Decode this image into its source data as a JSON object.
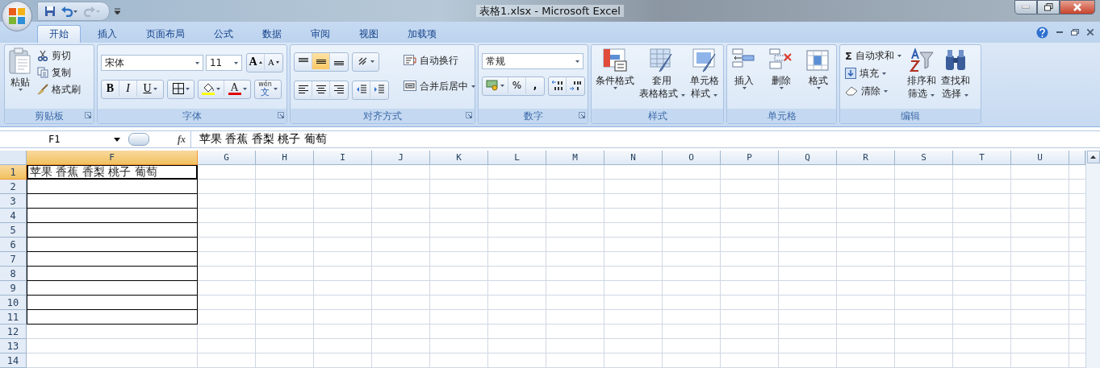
{
  "window": {
    "title": "表格1.xlsx  -  Microsoft Excel"
  },
  "tabs": [
    {
      "label": "开始",
      "selected": true
    },
    {
      "label": "插入",
      "selected": false
    },
    {
      "label": "页面布局",
      "selected": false
    },
    {
      "label": "公式",
      "selected": false
    },
    {
      "label": "数据",
      "selected": false
    },
    {
      "label": "审阅",
      "selected": false
    },
    {
      "label": "视图",
      "selected": false
    },
    {
      "label": "加载项",
      "selected": false
    }
  ],
  "ribbon": {
    "clipboard": {
      "label": "剪贴板",
      "paste": "粘贴",
      "cut": "剪切",
      "copy": "复制",
      "format_painter": "格式刷"
    },
    "font": {
      "label": "字体",
      "font_name": "宋体",
      "font_size": "11",
      "grow": "A",
      "shrink": "A",
      "bold": "B",
      "italic": "I",
      "underline": "U",
      "font_color": "A",
      "phonetic": "wén",
      "phonetic_char": "文"
    },
    "alignment": {
      "label": "对齐方式",
      "vertical": [
        {
          "selected": false
        },
        {
          "selected": true
        },
        {
          "selected": false
        }
      ],
      "wrap_text": "自动换行",
      "merge_center": "合并后居中"
    },
    "number": {
      "label": "数字",
      "format": "常规",
      "percent": "%",
      "comma": ","
    },
    "styles": {
      "label": "样式",
      "buttons": [
        {
          "lines": [
            "条件格式"
          ]
        },
        {
          "lines": [
            "套用",
            "表格格式"
          ]
        },
        {
          "lines": [
            "单元格",
            "样式"
          ]
        }
      ]
    },
    "cells": {
      "label": "单元格",
      "buttons": [
        {
          "lines": [
            "插入"
          ]
        },
        {
          "lines": [
            "删除"
          ]
        },
        {
          "lines": [
            "格式"
          ]
        }
      ]
    },
    "editing": {
      "label": "编辑",
      "autosum_symbol": "Σ",
      "autosum": "自动求和",
      "fill": "填充",
      "clear": "清除",
      "buttons": [
        {
          "lines": [
            "排序和",
            "筛选"
          ]
        },
        {
          "lines": [
            "查找和",
            "选择"
          ]
        }
      ]
    }
  },
  "formula_bar": {
    "name_box": "F1",
    "fx": "fx",
    "value": "苹果 香蕉 香梨 桃子 葡萄"
  },
  "sheet": {
    "columns": [
      {
        "label": "F",
        "selected": true
      },
      {
        "label": "G",
        "selected": false
      },
      {
        "label": "H",
        "selected": false
      },
      {
        "label": "I",
        "selected": false
      },
      {
        "label": "J",
        "selected": false
      },
      {
        "label": "K",
        "selected": false
      },
      {
        "label": "L",
        "selected": false
      },
      {
        "label": "M",
        "selected": false
      },
      {
        "label": "N",
        "selected": false
      },
      {
        "label": "O",
        "selected": false
      },
      {
        "label": "P",
        "selected": false
      },
      {
        "label": "Q",
        "selected": false
      },
      {
        "label": "R",
        "selected": false
      },
      {
        "label": "S",
        "selected": false
      },
      {
        "label": "T",
        "selected": false
      },
      {
        "label": "U",
        "selected": false
      }
    ],
    "rows": [
      {
        "label": "1",
        "selected": true,
        "bordered": true,
        "cell": "苹果 香蕉 香梨 桃子 葡萄"
      },
      {
        "label": "2",
        "selected": false,
        "bordered": true
      },
      {
        "label": "3",
        "selected": false,
        "bordered": true
      },
      {
        "label": "4",
        "selected": false,
        "bordered": true
      },
      {
        "label": "5",
        "selected": false,
        "bordered": true
      },
      {
        "label": "6",
        "selected": false,
        "bordered": true
      },
      {
        "label": "7",
        "selected": false,
        "bordered": true
      },
      {
        "label": "8",
        "selected": false,
        "bordered": true
      },
      {
        "label": "9",
        "selected": false,
        "bordered": true
      },
      {
        "label": "10",
        "selected": false,
        "bordered": true
      },
      {
        "label": "11",
        "selected": false,
        "bordered": true
      },
      {
        "label": "12",
        "selected": false,
        "bordered": false
      },
      {
        "label": "13",
        "selected": false,
        "bordered": false
      },
      {
        "label": "14",
        "selected": false,
        "bordered": false
      }
    ]
  }
}
